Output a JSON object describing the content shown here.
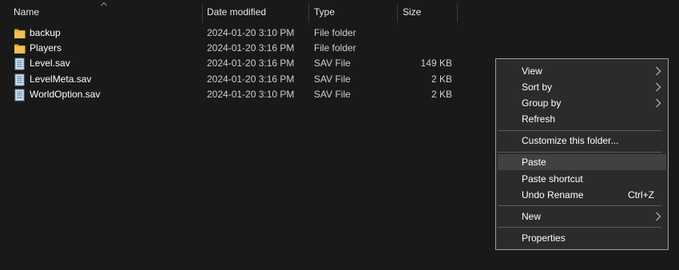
{
  "columns": {
    "name": "Name",
    "date_modified": "Date modified",
    "type": "Type",
    "size": "Size"
  },
  "files": [
    {
      "name": "backup",
      "date": "2024-01-20 3:10 PM",
      "type": "File folder",
      "size": "",
      "icon": "folder-icon"
    },
    {
      "name": "Players",
      "date": "2024-01-20 3:16 PM",
      "type": "File folder",
      "size": "",
      "icon": "folder-icon"
    },
    {
      "name": "Level.sav",
      "date": "2024-01-20 3:16 PM",
      "type": "SAV File",
      "size": "149 KB",
      "icon": "file-icon"
    },
    {
      "name": "LevelMeta.sav",
      "date": "2024-01-20 3:16 PM",
      "type": "SAV File",
      "size": "2 KB",
      "icon": "file-icon"
    },
    {
      "name": "WorldOption.sav",
      "date": "2024-01-20 3:10 PM",
      "type": "SAV File",
      "size": "2 KB",
      "icon": "file-icon"
    }
  ],
  "context_menu": {
    "view": "View",
    "sort_by": "Sort by",
    "group_by": "Group by",
    "refresh": "Refresh",
    "customize": "Customize this folder...",
    "paste": "Paste",
    "paste_shortcut": "Paste shortcut",
    "undo_rename": "Undo Rename",
    "undo_rename_key": "Ctrl+Z",
    "new": "New",
    "properties": "Properties"
  },
  "colors": {
    "background": "#191919",
    "menu_background": "#2b2b2b",
    "menu_hover": "#414141",
    "folder": "#f3c04f"
  }
}
